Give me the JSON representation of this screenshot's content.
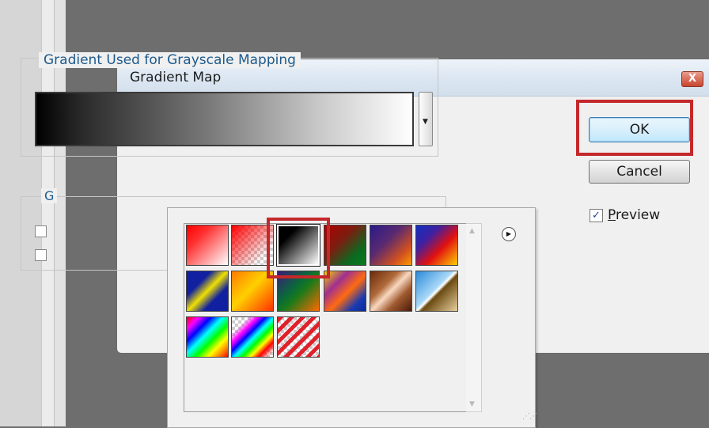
{
  "window": {
    "title": "Gradient Map"
  },
  "gradient_group": {
    "label": "Gradient Used for Grayscale Mapping"
  },
  "options_group": {
    "label_partial": "G"
  },
  "buttons": {
    "ok": "OK",
    "cancel": "Cancel",
    "close_glyph": "X"
  },
  "preview": {
    "label_first": "P",
    "label_rest": "review",
    "checked": true,
    "check_glyph": "✓"
  },
  "picker": {
    "menu_glyph": "▶",
    "scroll_up": "▲",
    "scroll_down": "▼",
    "selected_index": 2,
    "swatches": [
      {
        "name": "foreground-to-background"
      },
      {
        "name": "foreground-to-transparent"
      },
      {
        "name": "black-white"
      },
      {
        "name": "red-green"
      },
      {
        "name": "violet-orange"
      },
      {
        "name": "blue-red-yellow"
      },
      {
        "name": "blue-yellow-blue"
      },
      {
        "name": "orange-yellow-orange"
      },
      {
        "name": "violet-green-orange"
      },
      {
        "name": "yellow-violet-orange-blue"
      },
      {
        "name": "copper"
      },
      {
        "name": "chrome"
      },
      {
        "name": "spectrum"
      },
      {
        "name": "transparent-rainbow"
      },
      {
        "name": "transparent-stripes"
      }
    ]
  },
  "colors": {
    "highlight": "#c4282a",
    "group_label": "#1d5a8c"
  }
}
